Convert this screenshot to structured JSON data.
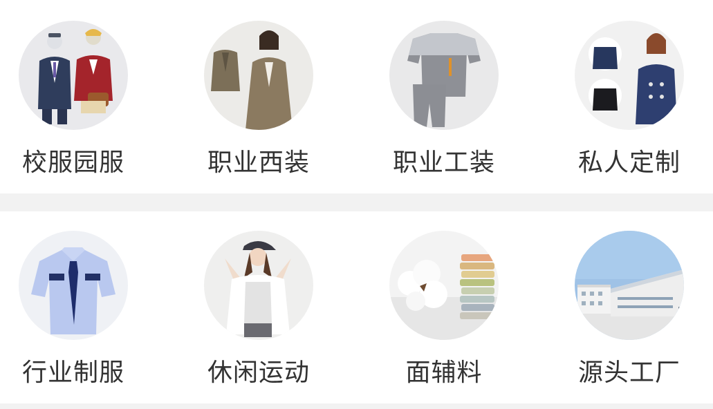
{
  "categories": {
    "row1": [
      {
        "label": "校服园服",
        "icon": "school-uniform-icon"
      },
      {
        "label": "职业西装",
        "icon": "business-suit-icon"
      },
      {
        "label": "职业工装",
        "icon": "workwear-icon"
      },
      {
        "label": "私人定制",
        "icon": "custom-tailoring-icon"
      }
    ],
    "row2": [
      {
        "label": "行业制服",
        "icon": "industry-uniform-icon"
      },
      {
        "label": "休闲运动",
        "icon": "casual-sports-icon"
      },
      {
        "label": "面辅料",
        "icon": "fabric-materials-icon"
      },
      {
        "label": "源头工厂",
        "icon": "factory-icon"
      }
    ]
  },
  "colors": {
    "page_bg": "#f2f2f2",
    "card_bg": "#ffffff",
    "label_text": "#333333"
  }
}
